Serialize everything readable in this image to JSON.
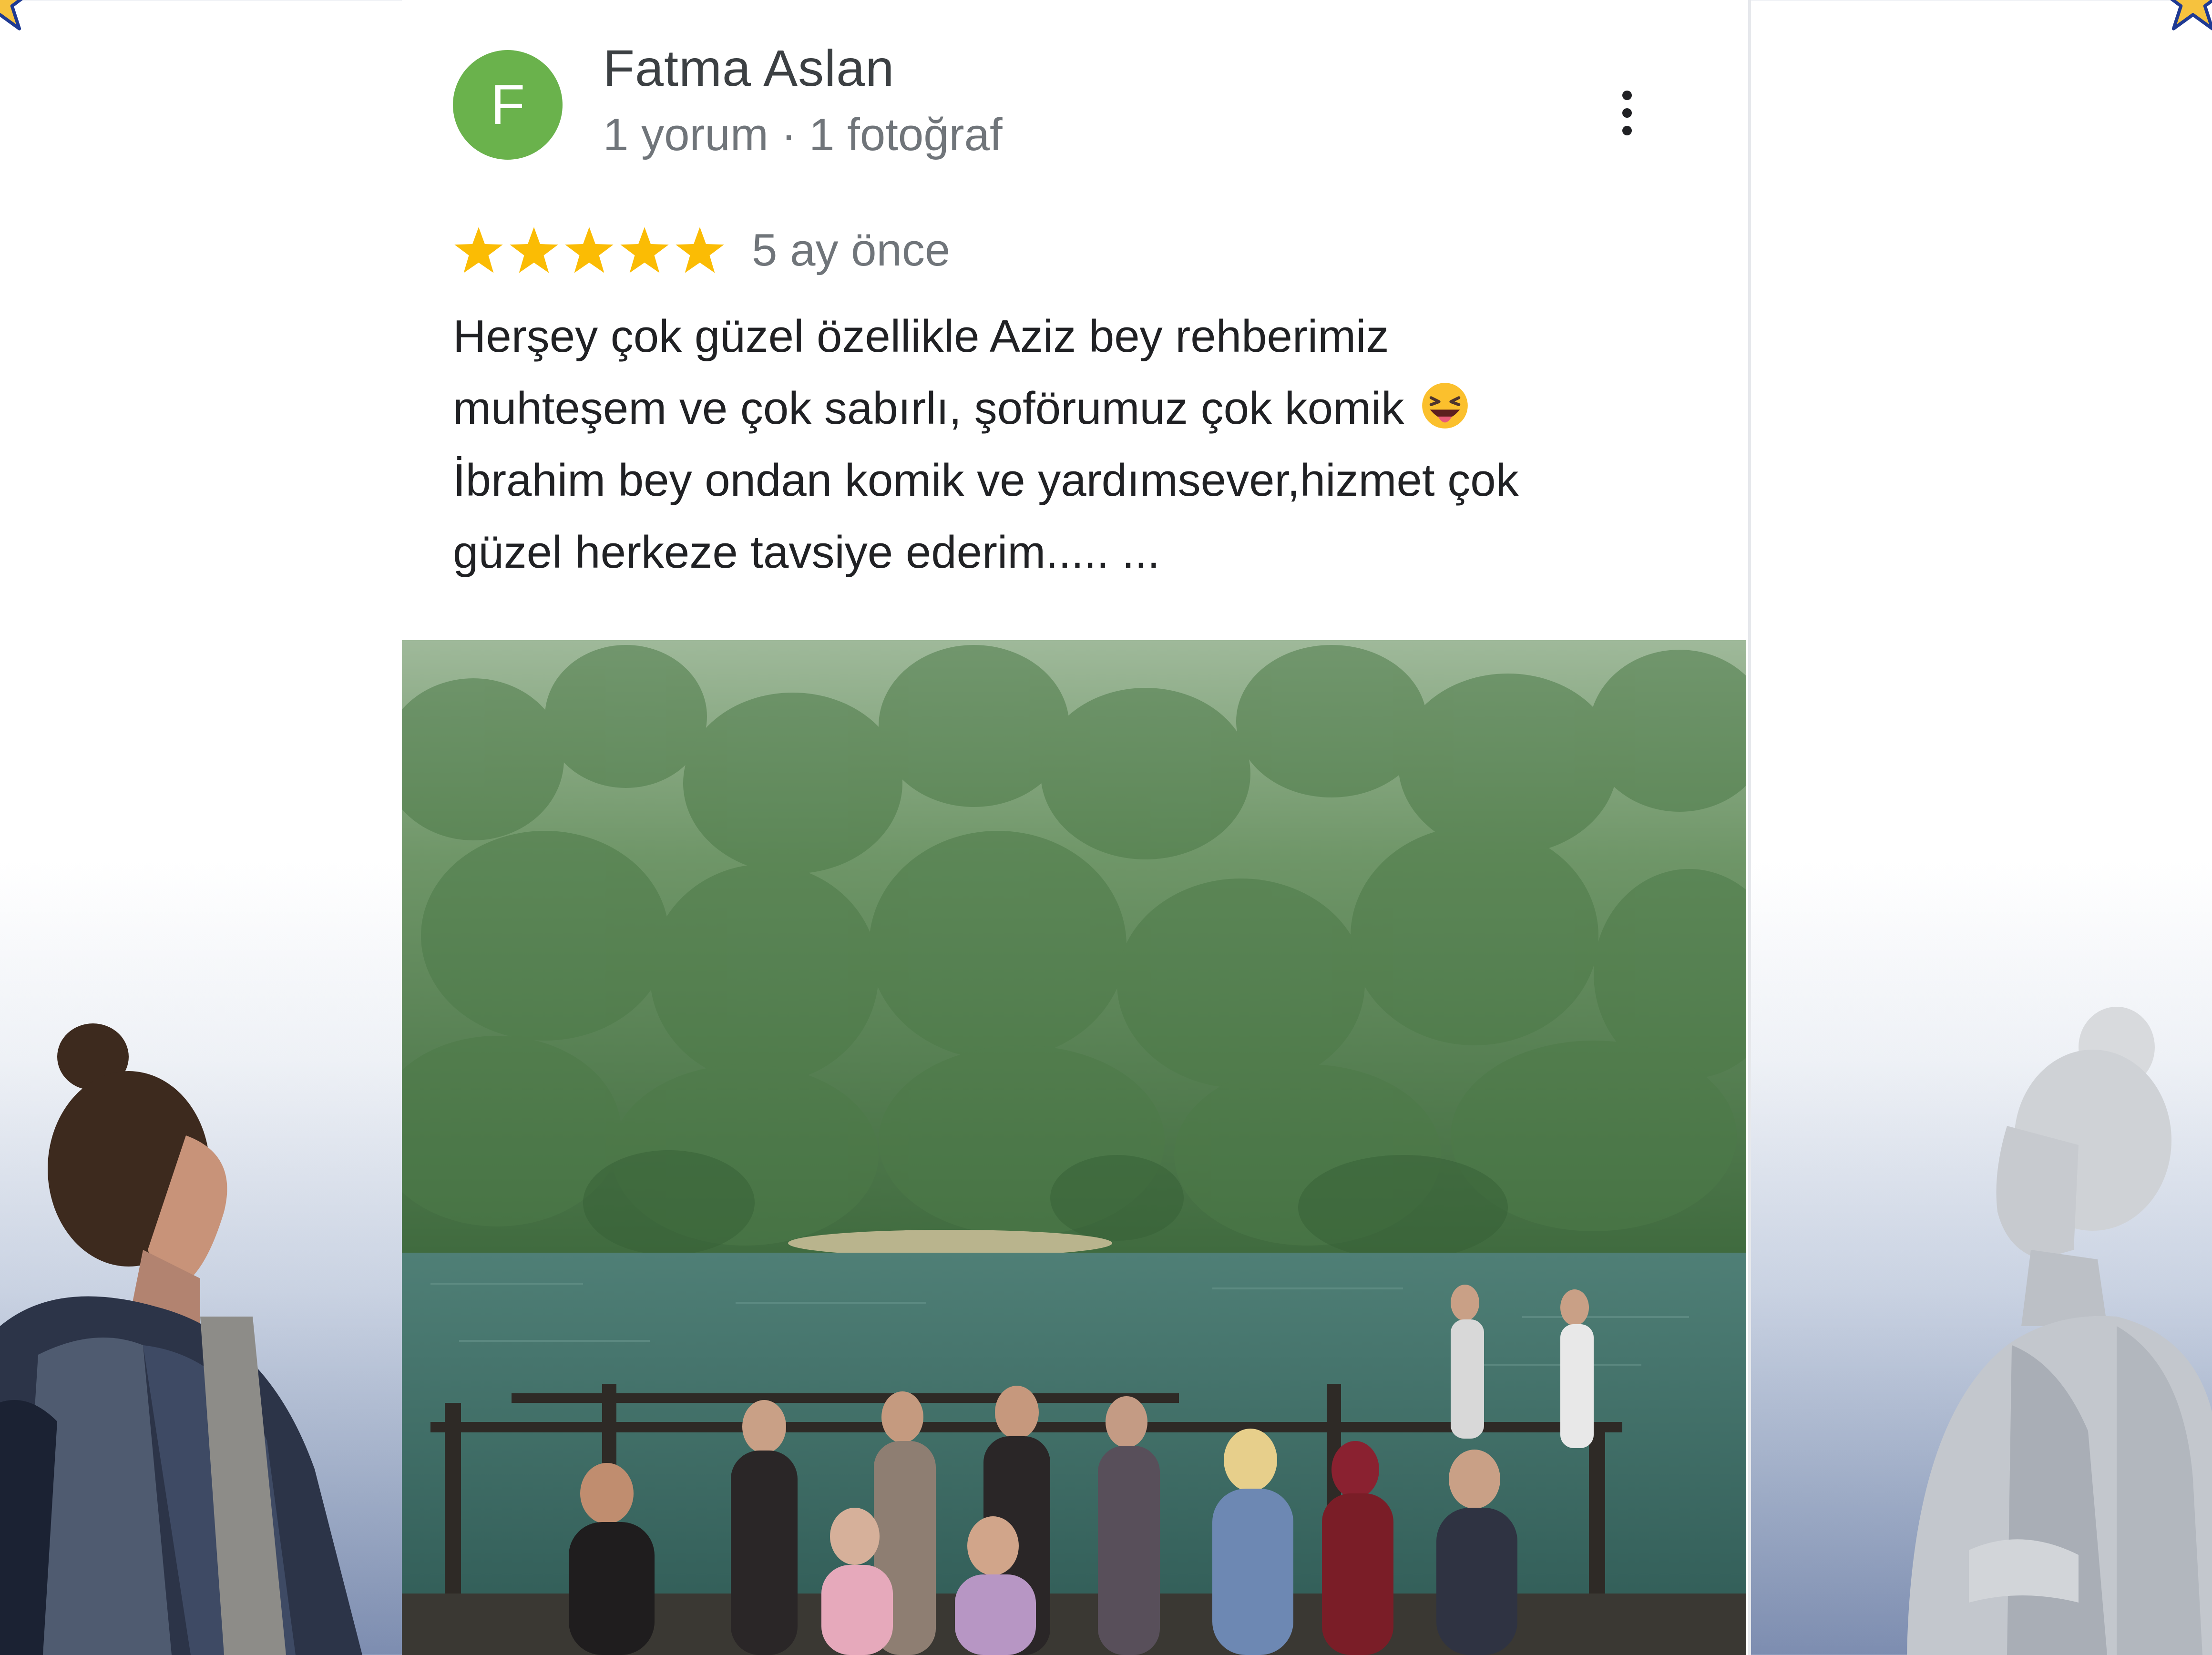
{
  "review": {
    "avatar_letter": "F",
    "author": "Fatma Aslan",
    "meta": "1 yorum · 1 fotoğraf",
    "rating": 5,
    "rating_max": 5,
    "time_ago": "5 ay önce",
    "text_lines": [
      "Herşey çok güzel özellikle Aziz bey rehberimiz",
      "muhteşem ve çok sabırlı, şoförumuz çok komik",
      "İbrahim bey ondan komik ve yardımsever,hizmet çok",
      "güzel herkeze tavsiye ederim..... ..."
    ],
    "emoji": "grinning-squinting-face-with-tongue-icon",
    "photo": "group-photo-lake-forest"
  },
  "colors": {
    "avatar": "#6ab24c",
    "star": "#fbbc04",
    "author": "#3c4043",
    "secondary": "#70757a",
    "body_text": "#202124",
    "corner_star": "#f6c23e",
    "corner_star_outline": "#1f3a93"
  },
  "icons": {
    "more": "more-vertical-icon",
    "corner_star": "star-icon"
  }
}
